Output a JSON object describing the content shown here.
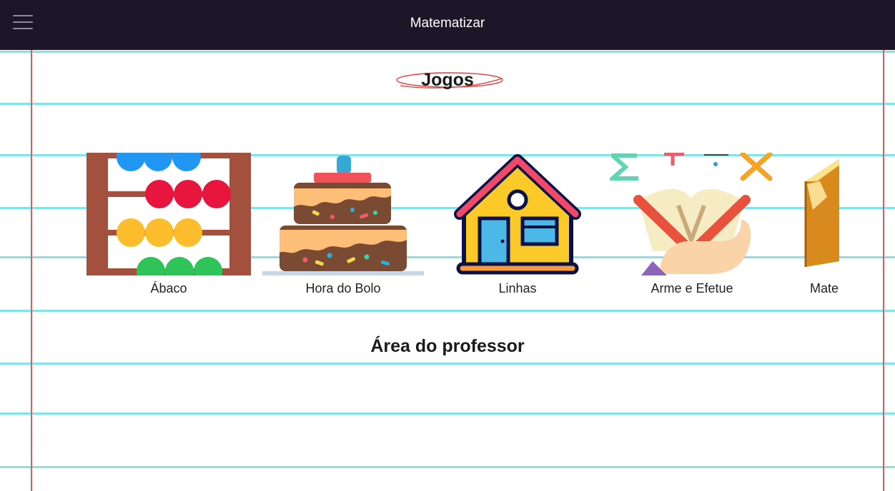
{
  "header": {
    "title": "Matematizar",
    "menu_icon": "hamburger-menu-icon",
    "background": "#1b1728"
  },
  "games_section": {
    "title": "Jogos",
    "items": [
      {
        "label": "Ábaco",
        "icon": "abacus-icon"
      },
      {
        "label": "Hora do Bolo",
        "icon": "cake-icon"
      },
      {
        "label": "Linhas",
        "icon": "house-icon"
      },
      {
        "label": "Arme e Efetue",
        "icon": "math-book-icon"
      },
      {
        "label": "Mate",
        "icon": "box-icon"
      }
    ]
  },
  "teacher_section": {
    "title": "Área do professor"
  },
  "colors": {
    "rule_line": "#7fe5ea",
    "margin_line": "#e05a5a",
    "text": "#1a1a1a"
  }
}
